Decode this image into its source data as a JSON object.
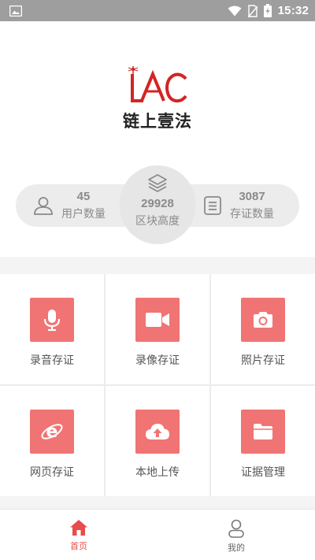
{
  "status_bar": {
    "time": "15:32",
    "icons": [
      "gallery-icon",
      "wifi-icon",
      "no-sim-icon",
      "battery-charging-icon"
    ]
  },
  "logo": {
    "mark": "LAC",
    "title": "链上壹法"
  },
  "stats": {
    "users": {
      "value": "45",
      "label": "用户数量",
      "icon": "user-icon"
    },
    "blocks": {
      "value": "29928",
      "label": "区块高度",
      "icon": "layers-icon"
    },
    "certificates": {
      "value": "3087",
      "label": "存证数量",
      "icon": "document-list-icon"
    }
  },
  "grid": {
    "items": [
      {
        "label": "录音存证",
        "icon": "microphone-icon"
      },
      {
        "label": "录像存证",
        "icon": "video-camera-icon"
      },
      {
        "label": "照片存证",
        "icon": "camera-icon"
      },
      {
        "label": "网页存证",
        "icon": "browser-e-icon"
      },
      {
        "label": "本地上传",
        "icon": "cloud-upload-icon"
      },
      {
        "label": "证据管理",
        "icon": "folder-icon"
      }
    ]
  },
  "bottom_nav": {
    "home": {
      "label": "首页",
      "icon": "home-icon",
      "active": true
    },
    "mine": {
      "label": "我的",
      "icon": "person-icon",
      "active": false
    }
  },
  "colors": {
    "accent": "#e84c4c",
    "tile": "#f07474",
    "status_bar": "#9e9e9e"
  }
}
